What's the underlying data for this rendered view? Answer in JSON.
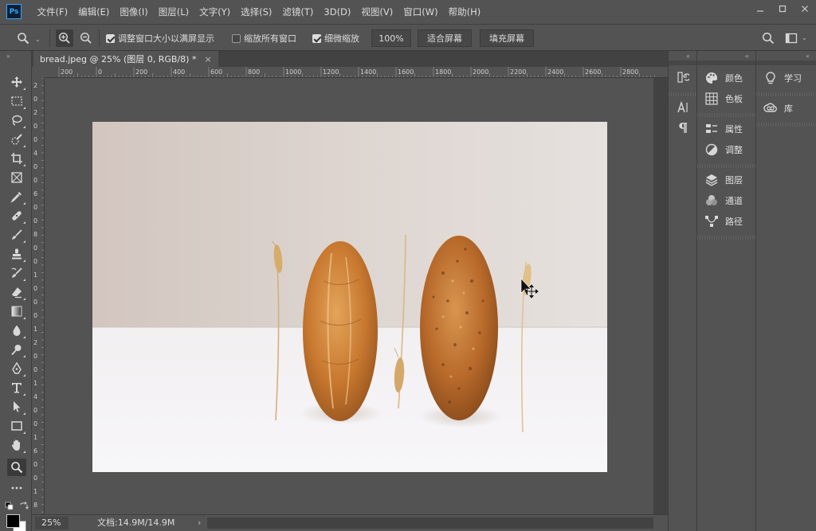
{
  "app": {
    "logo": "Ps"
  },
  "menu": [
    "文件(F)",
    "编辑(E)",
    "图像(I)",
    "图层(L)",
    "文字(Y)",
    "选择(S)",
    "滤镜(T)",
    "3D(D)",
    "视图(V)",
    "窗口(W)",
    "帮助(H)"
  ],
  "options": {
    "resize_windows_label": "调整窗口大小以满屏显示",
    "resize_windows_checked": true,
    "zoom_all_label": "缩放所有窗口",
    "zoom_all_checked": false,
    "scrubby_label": "细微缩放",
    "scrubby_checked": true,
    "zoom_100": "100%",
    "fit_screen": "适合屏幕",
    "fill_screen": "填充屏幕"
  },
  "document": {
    "tab_title": "bread.jpeg @ 25% (图层 0, RGB/8) *",
    "close": "×"
  },
  "ruler": {
    "h_labels": [
      "200",
      "0",
      "200",
      "400",
      "600",
      "800",
      "1000",
      "1200",
      "1400",
      "1600",
      "1800",
      "2000",
      "2200",
      "2400",
      "2600",
      "2800"
    ],
    "v_labels": [
      "2",
      "0",
      "2",
      "0",
      "0",
      "4",
      "0",
      "0",
      "6",
      "0",
      "0",
      "8",
      "0",
      "0",
      "1",
      "0",
      "0",
      "0",
      "1",
      "2",
      "0",
      "0",
      "1",
      "4",
      "0",
      "0",
      "1",
      "6",
      "0",
      "0",
      "1",
      "8"
    ]
  },
  "status": {
    "zoom": "25%",
    "doc_info": "文档:14.9M/14.9M",
    "arrow": "›"
  },
  "panels": {
    "group1": [
      {
        "label": "颜色",
        "icon": "palette-icon"
      },
      {
        "label": "色板",
        "icon": "swatches-icon"
      }
    ],
    "group2": [
      {
        "label": "属性",
        "icon": "properties-icon"
      },
      {
        "label": "调整",
        "icon": "adjustments-icon"
      }
    ],
    "group3": [
      {
        "label": "图层",
        "icon": "layers-icon"
      },
      {
        "label": "通道",
        "icon": "channels-icon"
      },
      {
        "label": "路径",
        "icon": "paths-icon"
      }
    ],
    "learn": "学习",
    "library": "库"
  },
  "colors": {
    "ui_bg": "#535353",
    "ui_dark": "#424242",
    "accent": "#31a8ff",
    "photo_wall": "#d8cfc8",
    "photo_table": "#f4f2f3",
    "bread": "#c97a35"
  }
}
